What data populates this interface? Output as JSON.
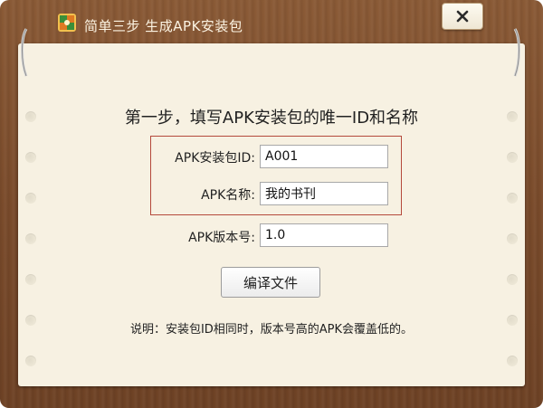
{
  "window": {
    "title": "简单三步 生成APK安装包",
    "close_label": "×"
  },
  "step": {
    "heading": "第一步，填写APK安装包的唯一ID和名称"
  },
  "form": {
    "id_label": "APK安装包ID:",
    "id_value": "A001",
    "name_label": "APK名称:",
    "name_value": "我的书刊",
    "version_label": "APK版本号:",
    "version_value": "1.0"
  },
  "actions": {
    "compile_label": "编译文件"
  },
  "note": {
    "text": "说明：安装包ID相同时，版本号高的APK会覆盖低的。"
  },
  "colors": {
    "wood": "#7a4b2b",
    "paper": "#f7f1e2",
    "highlight_border": "#b4493b",
    "title_text": "#fbf3e2"
  },
  "icons": {
    "app_logo": "app-logo-icon",
    "close": "close-icon"
  }
}
